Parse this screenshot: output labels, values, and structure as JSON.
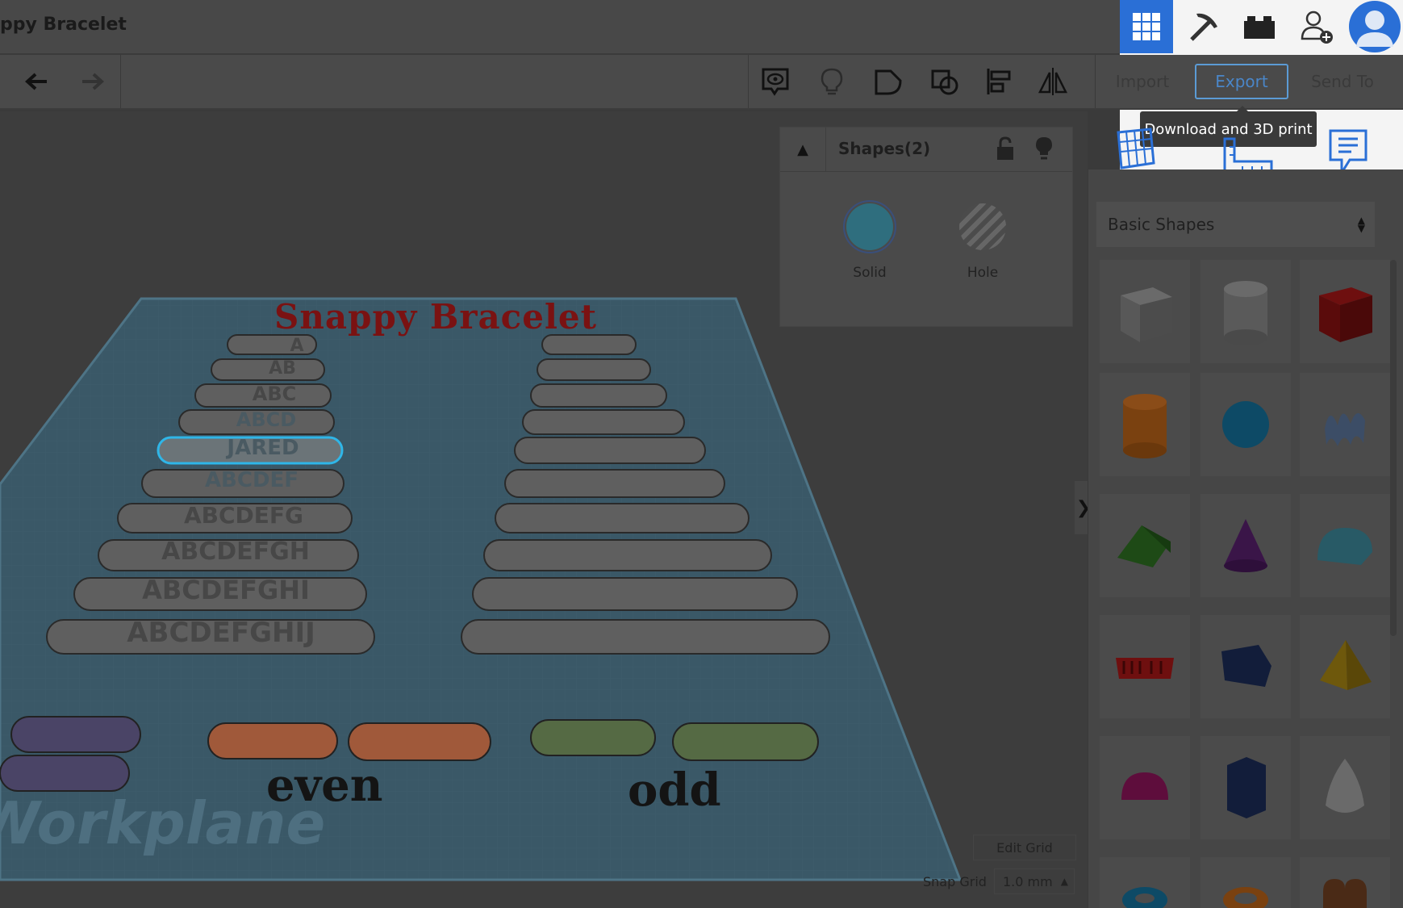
{
  "header": {
    "title": "ppy Bracelet"
  },
  "toolbar": {
    "undo_icon": "undo-arrow-icon",
    "redo_icon": "redo-arrow-icon"
  },
  "actions": {
    "import_label": "Import",
    "export_label": "Export",
    "send_to_label": "Send To",
    "export_tooltip": "Download and 3D print"
  },
  "shapes_panel": {
    "title": "Shapes(2)",
    "solid_label": "Solid",
    "hole_label": "Hole"
  },
  "library": {
    "category": "Basic Shapes"
  },
  "workplane": {
    "design_title": "Snappy Bracelet",
    "watermark": "Workplane",
    "left_labels": [
      "A",
      "AB",
      "ABC",
      "ABCD",
      "JARED",
      "ABCDEF",
      "ABCDEFG",
      "ABCDEFGH",
      "ABCDEFGHI",
      "ABCDEFGHIJ"
    ],
    "even_label": "even",
    "odd_label": "odd"
  },
  "grid": {
    "edit_grid_label": "Edit Grid",
    "snap_grid_label": "Snap Grid",
    "snap_grid_value": "1.0 mm"
  },
  "colors": {
    "accent_blue": "#2a6fd6",
    "export_border": "#5b9bd5",
    "solid_teal": "#2f6e7e",
    "title_red": "#7a1212"
  }
}
